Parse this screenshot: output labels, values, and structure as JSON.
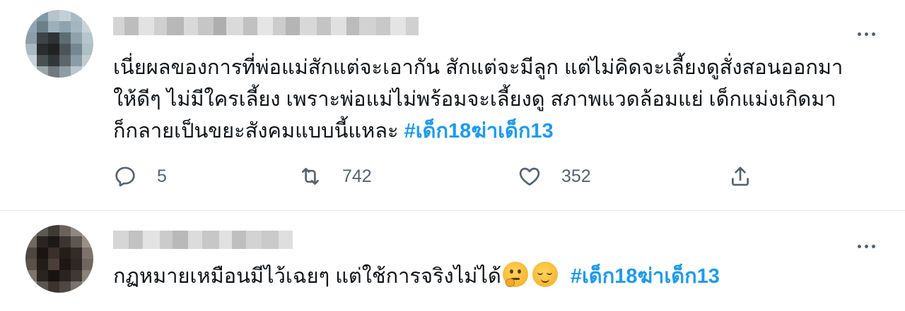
{
  "tweets": [
    {
      "text": "เนี่ยผลของการที่พ่อแม่สักแต่จะเอากัน สักแต่จะมีลูก แต่ไม่คิดจะเลี้ยงดูสั่งสอนออกมา",
      "text_line2": "ให้ดีๆ ไม่มีใครเลี้ยง เพราะพ่อแม่ไม่พร้อมจะเลี้ยงดู สภาพแวดล้อมแย่ เด็กแม่งเกิดมา",
      "text_line3": "ก็กลายเป็นขยะสังคมแบบนี้แหละ ",
      "hashtag": "#เด็ก18ฆ่าเด็ก13",
      "actions": {
        "replies": "5",
        "retweets": "742",
        "likes": "352"
      }
    },
    {
      "text": "กฏหมายเหมือนมีไว้เฉยๆ แต่ใช้การจริงไม่ได้",
      "hashtag": "#เด็ก18ฆ่าเด็ก13",
      "emojis": [
        "thinking-face-emoji",
        "relieved-face-emoji"
      ]
    }
  ],
  "icons": {
    "reply": "reply-icon",
    "retweet": "retweet-icon",
    "like": "heart-icon",
    "share": "share-icon",
    "more": "more-icon"
  },
  "colors": {
    "hashtag": "#1d9bf0",
    "secondary": "#536471",
    "divider": "#e6ecf0"
  }
}
